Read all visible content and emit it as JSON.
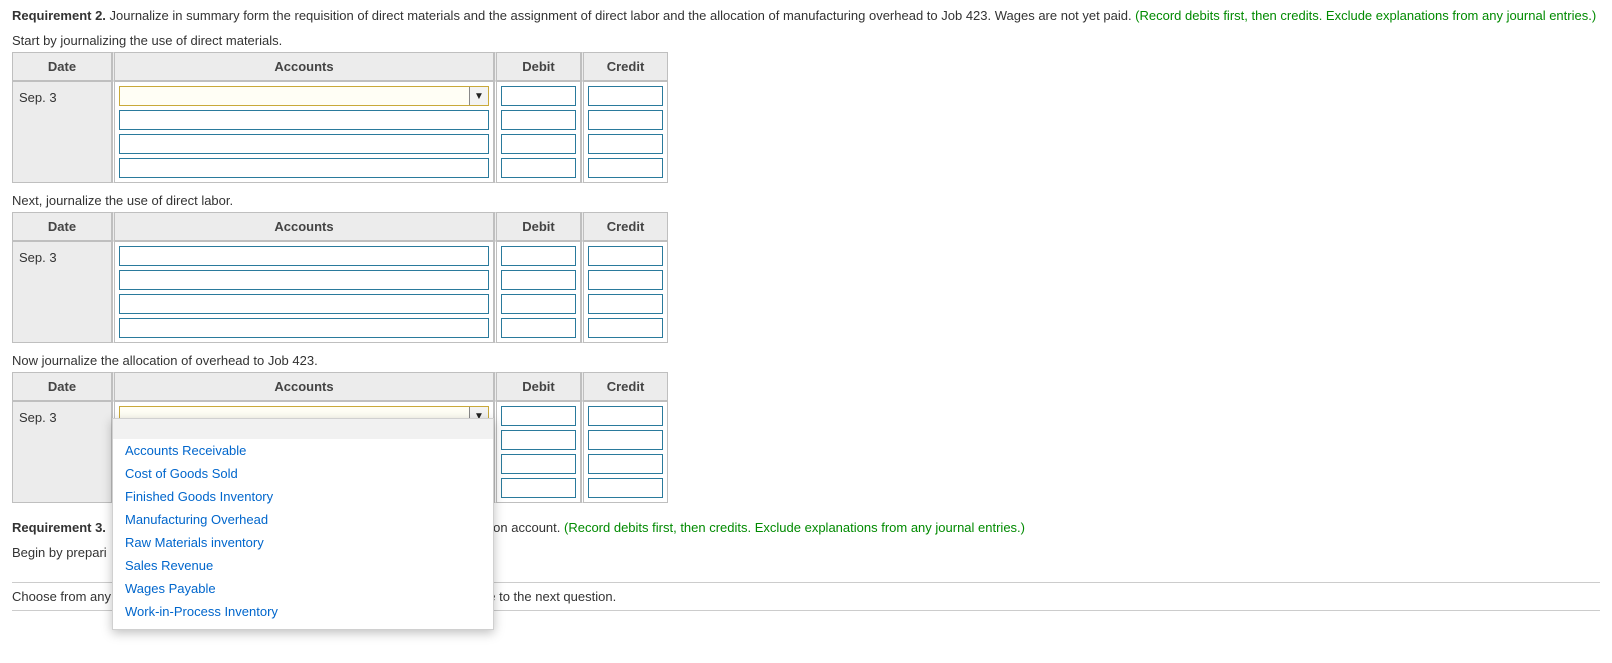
{
  "req2": {
    "label": "Requirement 2.",
    "text": " Journalize in summary form the requisition of direct materials and the assignment of direct labor and the allocation of manufacturing overhead to Job 423. Wages are not yet paid. ",
    "hint": "(Record debits first, then credits. Exclude explanations from any journal entries.)"
  },
  "instr1": "Start by journalizing the use of direct materials.",
  "instr2": "Next, journalize the use of direct labor.",
  "instr3": "Now journalize the allocation of overhead to Job 423.",
  "headers": {
    "date": "Date",
    "accounts": "Accounts",
    "debit": "Debit",
    "credit": "Credit"
  },
  "date": "Sep. 3",
  "dropdown_options": [
    "Accounts Receivable",
    "Cost of Goods Sold",
    "Finished Goods Inventory",
    "Manufacturing Overhead",
    "Raw Materials inventory",
    "Sales Revenue",
    "Wages Payable",
    "Work-in-Process Inventory"
  ],
  "req3": {
    "label": "Requirement 3.",
    "mid": "on account. ",
    "hint": "(Record debits first, then credits. Exclude explanations from any journal entries.)"
  },
  "begin": "Begin by prepari",
  "footer_left": "Choose from any",
  "footer_right": "e to the next question."
}
